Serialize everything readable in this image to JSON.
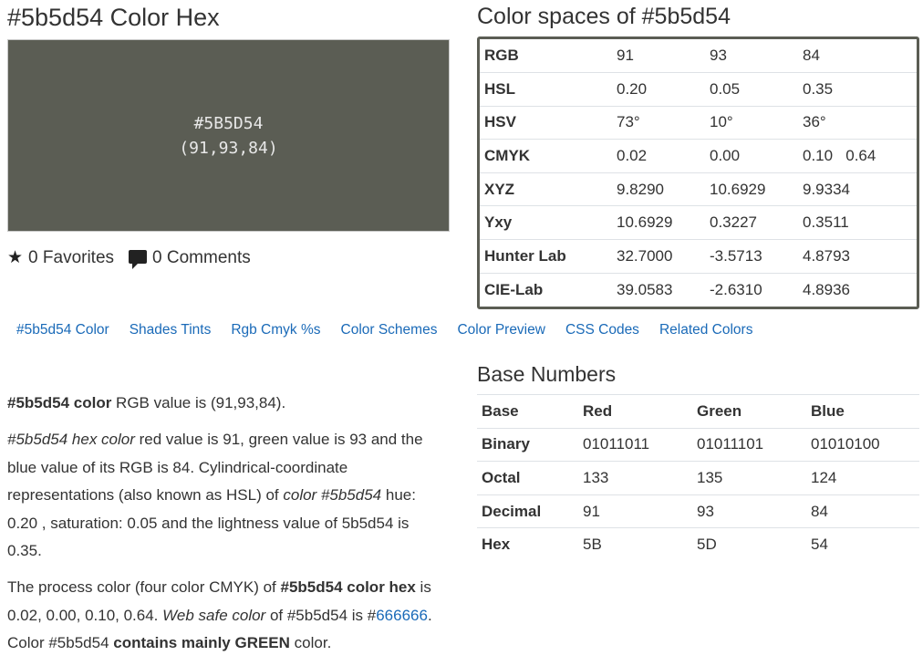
{
  "title": "#5b5d54 Color Hex",
  "color_spaces_title": "Color spaces of #5b5d54",
  "swatch": {
    "hex": "#5B5D54",
    "rgb": "(91,93,84)",
    "color": "#5b5d54"
  },
  "stats": {
    "favorites": "0 Favorites",
    "comments": "0 Comments"
  },
  "color_spaces": [
    {
      "label": "RGB",
      "v1": "91",
      "v2": "93",
      "v3": "84"
    },
    {
      "label": "HSL",
      "v1": "0.20",
      "v2": "0.05",
      "v3": "0.35"
    },
    {
      "label": "HSV",
      "v1": "73°",
      "v2": "10°",
      "v3": "36°"
    },
    {
      "label": "CMYK",
      "v1": "0.02",
      "v2": "0.00",
      "v3": "0.10   0.64"
    },
    {
      "label": "XYZ",
      "v1": "9.8290",
      "v2": "10.6929",
      "v3": "9.9334"
    },
    {
      "label": "Yxy",
      "v1": "10.6929",
      "v2": "0.3227",
      "v3": "0.3511"
    },
    {
      "label": "Hunter Lab",
      "v1": "32.7000",
      "v2": "-3.5713",
      "v3": "4.8793"
    },
    {
      "label": "CIE-Lab",
      "v1": "39.0583",
      "v2": "-2.6310",
      "v3": "4.8936"
    }
  ],
  "nav": [
    "#5b5d54 Color",
    "Shades Tints",
    "Rgb Cmyk %s",
    "Color Schemes",
    "Color Preview",
    "CSS Codes",
    "Related Colors"
  ],
  "p1": {
    "bold": "#5b5d54 color",
    "rest": " RGB value is (91,93,84)."
  },
  "p2": {
    "i1": "#5b5d54 hex color",
    "t1": " red value is 91, green value is 93 and the blue value of its RGB is 84. Cylindrical-coordinate representations (also known as HSL) of ",
    "i2": "color #5b5d54",
    "t2": " hue: 0.20 , saturation: 0.05 and the lightness value of 5b5d54 is 0.35."
  },
  "p3": {
    "t1": "The process color (four color CMYK) of ",
    "b1": "#5b5d54 color hex",
    "t2": " is 0.02, 0.00, 0.10, 0.64. ",
    "i1": "Web safe color",
    "t3": " of #5b5d54 is ",
    "link_hash": "#",
    "link": "666666",
    "t4": ". Color #5b5d54 ",
    "b2": "contains mainly GREEN",
    "t5": " color."
  },
  "base_title": "Base Numbers",
  "base_headers": [
    "Base",
    "Red",
    "Green",
    "Blue"
  ],
  "base_rows": [
    {
      "label": "Binary",
      "r": "01011011",
      "g": "01011101",
      "b": "01010100"
    },
    {
      "label": "Octal",
      "r": "133",
      "g": "135",
      "b": "124"
    },
    {
      "label": "Decimal",
      "r": "91",
      "g": "93",
      "b": "84"
    },
    {
      "label": "Hex",
      "r": "5B",
      "g": "5D",
      "b": "54"
    }
  ]
}
